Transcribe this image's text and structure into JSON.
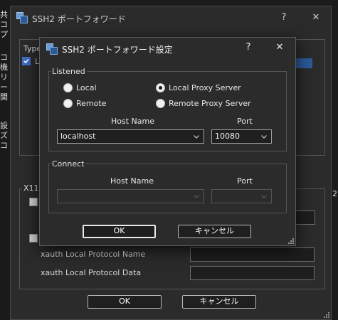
{
  "background_window": {
    "left_text": [
      "共",
      "コ",
      "プ",
      "コ",
      "機",
      "リ",
      "ー",
      "関",
      "設",
      "ズ",
      "コ"
    ],
    "right_text": "2"
  },
  "outer_dialog": {
    "title": "SSH2 ポートフォワード",
    "help_label": "?",
    "close_label": "✕",
    "type_label": "Type",
    "list_item_label": "L",
    "x11_group_label": "X11",
    "xauth_protocol_name_label": "xauth Local Protocol Name",
    "xauth_protocol_name_value": "",
    "xauth_protocol_data_label": "xauth Local Protocol Data",
    "xauth_protocol_data_value": "",
    "ok_label": "OK",
    "cancel_label": "キャンセル"
  },
  "front_dialog": {
    "title": "SSH2 ポートフォワード設定",
    "help_label": "?",
    "close_label": "✕",
    "listened": {
      "label": "Listened",
      "radios": [
        {
          "label": "Local",
          "checked": false
        },
        {
          "label": "Local Proxy Server",
          "checked": true
        },
        {
          "label": "Remote",
          "checked": false
        },
        {
          "label": "Remote Proxy Server",
          "checked": false
        }
      ],
      "host_name_label": "Host Name",
      "port_label": "Port",
      "host_name_value": "localhost",
      "port_value": "10080"
    },
    "connect": {
      "label": "Connect",
      "host_name_label": "Host Name",
      "port_label": "Port",
      "host_name_value": "",
      "port_value": ""
    },
    "ok_label": "OK",
    "cancel_label": "キャンセル"
  },
  "colors": {
    "dialog_bg": "#2b2b2b",
    "accent_check": "#3d6ec6",
    "selection": "#2d5a9a"
  },
  "icons": {
    "app": "ssh-app-icon",
    "help": "help-icon",
    "close": "close-icon",
    "dropdown": "chevron-down-icon",
    "resize": "resize-grip-icon"
  }
}
